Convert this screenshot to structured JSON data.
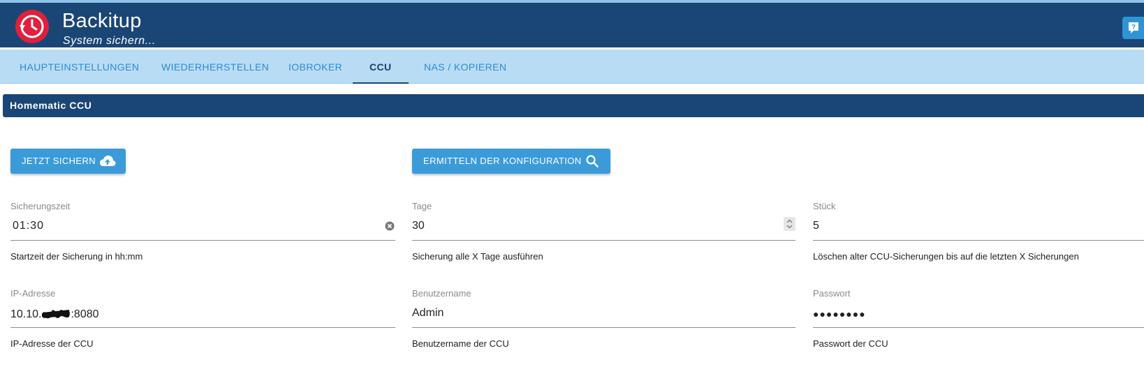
{
  "app": {
    "title": "Backitup",
    "subtitle": "System sichern..."
  },
  "tabs": [
    {
      "label": "HAUPTEINSTELLUNGEN",
      "active": false
    },
    {
      "label": "WIEDERHERSTELLEN",
      "active": false
    },
    {
      "label": "IOBROKER",
      "active": false
    },
    {
      "label": "CCU",
      "active": true
    },
    {
      "label": "NAS / KOPIEREN",
      "active": false
    }
  ],
  "section": {
    "title": "Homematic CCU"
  },
  "buttons": {
    "backup_now": {
      "label": "JETZT SICHERN",
      "icon": "cloud-upload-icon"
    },
    "detect_config": {
      "label": "ERMITTELN DER KONFIGURATION",
      "icon": "search-icon"
    }
  },
  "fields": {
    "backup_time": {
      "label": "Sicherungszeit",
      "value": "01:30",
      "help": "Startzeit der Sicherung in hh:mm"
    },
    "days": {
      "label": "Tage",
      "value": "30",
      "help": "Sicherung alle X Tage ausführen"
    },
    "count": {
      "label": "Stück",
      "value": "5",
      "help": "Löschen alter CCU-Sicherungen bis auf die letzten X Sicherungen"
    },
    "ip": {
      "label": "IP-Adresse",
      "value_prefix": "10.10.",
      "value_suffix": ":8080",
      "help": "IP-Adresse der CCU"
    },
    "username": {
      "label": "Benutzername",
      "value": "Admin",
      "help": "Benutzername der CCU"
    },
    "password": {
      "label": "Passwort",
      "value": "●●●●●●●●",
      "help": "Passwort der CCU"
    }
  },
  "colors": {
    "header": "#1a4676",
    "tabbar": "#b9dcf5",
    "button": "#3b9bd8",
    "logo": "#e0203c"
  }
}
